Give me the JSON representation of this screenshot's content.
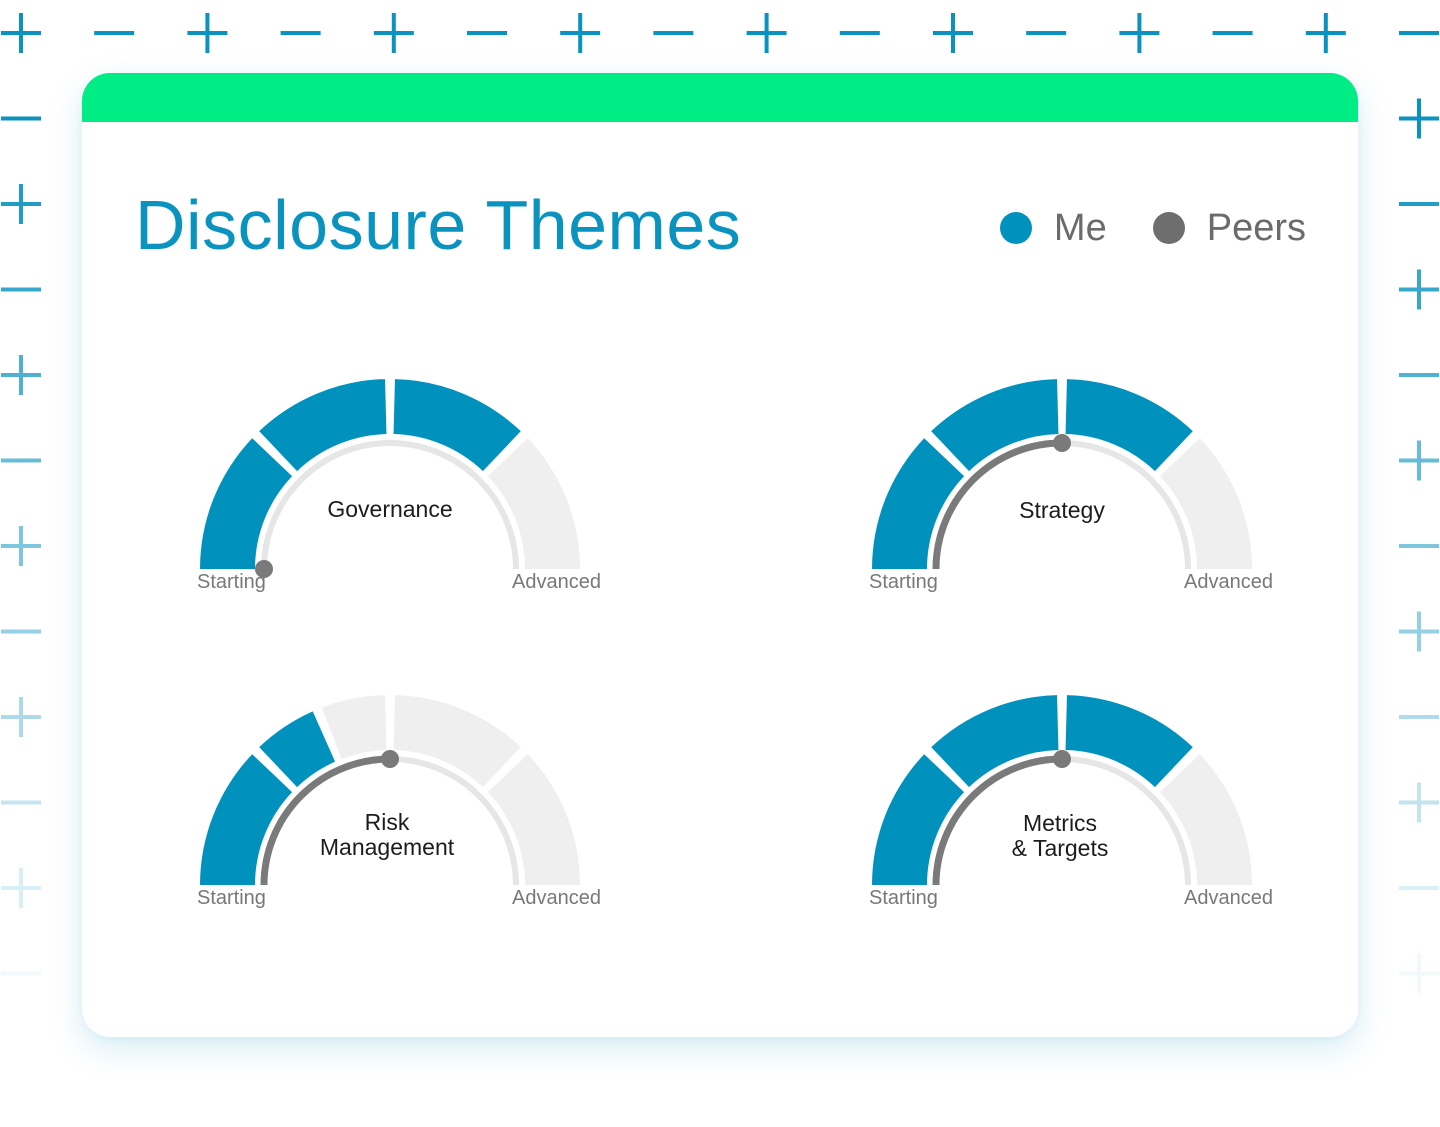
{
  "colors": {
    "accent_header": "#00ec85",
    "title": "#0b93bf",
    "me": "#0092bd",
    "peers": "#7a7a7a",
    "segment_empty": "#efefef",
    "track": "#e6e6e6",
    "pattern": "#0a93c0"
  },
  "page": {
    "title": "Disclosure Themes"
  },
  "legend": {
    "me_label": "Me",
    "peers_label": "Peers"
  },
  "gauges": [
    {
      "title": "Governance",
      "start_label": "Starting",
      "end_label": "Advanced",
      "me_filled_segments": 3,
      "total_segments": 4,
      "peers_level": 0.0
    },
    {
      "title": "Strategy",
      "start_label": "Starting",
      "end_label": "Advanced",
      "me_filled_segments": 3,
      "total_segments": 4,
      "peers_level": 0.5
    },
    {
      "title": "Risk\nManagement",
      "start_label": "Starting",
      "end_label": "Advanced",
      "me_filled_segments": 1.5,
      "total_segments": 4,
      "peers_level": 0.5
    },
    {
      "title": "Metrics\n& Targets",
      "start_label": "Starting",
      "end_label": "Advanced",
      "me_filled_segments": 3,
      "total_segments": 4,
      "peers_level": 0.5
    }
  ]
}
